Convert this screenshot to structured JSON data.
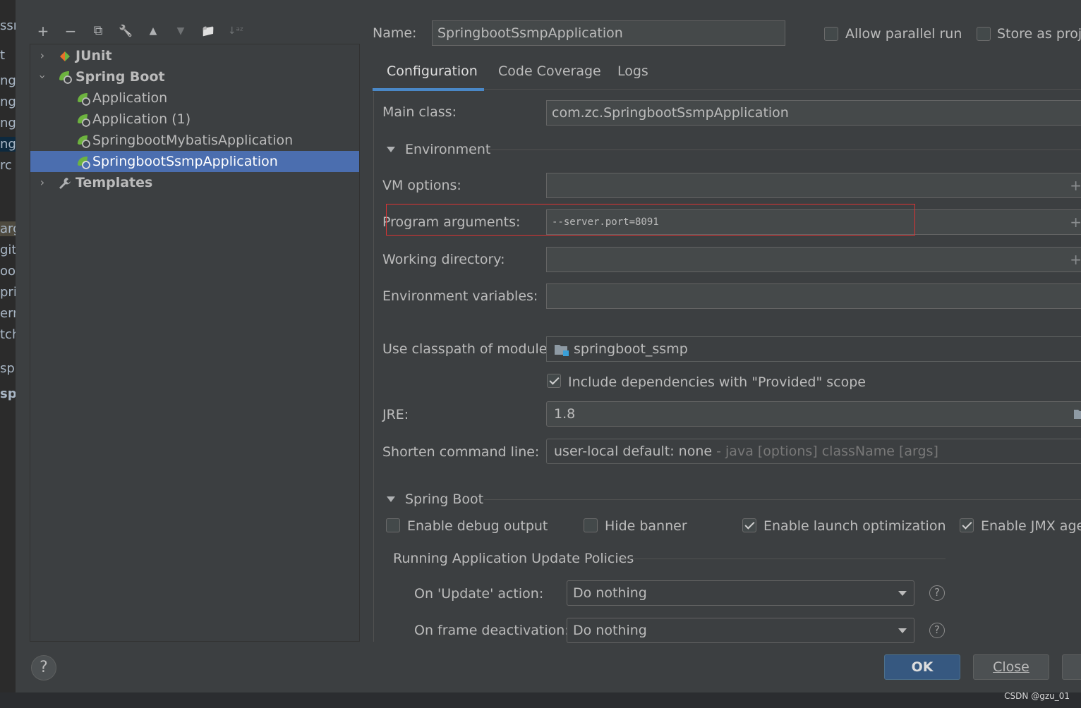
{
  "left_strip": {
    "lines": [
      "ssn",
      "t",
      "ng",
      "ng",
      "ng",
      "ng",
      "rc",
      "",
      "",
      "arg",
      "git",
      "oor",
      "pri",
      "ern",
      "tch",
      "sp",
      "sp"
    ]
  },
  "toolbar": {
    "add": "+",
    "remove": "−",
    "copy": "⧉",
    "edit_defaults": "🔧",
    "move_up": "▲",
    "move_down": "▼",
    "folder": "📁",
    "sort": "↓ᵃᶻ"
  },
  "tree": {
    "items": [
      {
        "label": "JUnit",
        "expanded": false
      },
      {
        "label": "Spring Boot",
        "expanded": true
      },
      {
        "label": "Application"
      },
      {
        "label": "Application (1)"
      },
      {
        "label": "SpringbootMybatisApplication"
      },
      {
        "label": "SpringbootSsmpApplication",
        "selected": true
      },
      {
        "label": "Templates",
        "expanded": false
      }
    ]
  },
  "header": {
    "name_label": "Name:",
    "name_value": "SpringbootSsmpApplication",
    "allow_parallel": "Allow parallel run",
    "store_as_project": "Store as proje"
  },
  "tabs": [
    {
      "label": "Configuration",
      "active": true
    },
    {
      "label": "Code Coverage"
    },
    {
      "label": "Logs"
    }
  ],
  "config": {
    "main_class_label": "Main class:",
    "main_class_value": "com.zc.SpringbootSsmpApplication",
    "environment_label": "Environment",
    "vm_options_label": "VM options:",
    "vm_options_value": "",
    "program_args_label": "Program arguments:",
    "program_args_value": "--server.port=8091",
    "working_dir_label": "Working directory:",
    "working_dir_value": "",
    "env_vars_label": "Environment variables:",
    "env_vars_value": "",
    "classpath_label": "Use classpath of module:",
    "classpath_value": "springboot_ssmp",
    "include_provided_label": "Include dependencies with \"Provided\" scope",
    "jre_label": "JRE:",
    "jre_value": "1.8",
    "shorten_label": "Shorten command line:",
    "shorten_value": "user-local default: none",
    "shorten_hint": " - java [options] className [args]"
  },
  "spring_boot": {
    "section_label": "Spring Boot",
    "debug_output": "Enable debug output",
    "hide_banner": "Hide banner",
    "launch_optimization": "Enable launch optimization",
    "jmx_agent": "Enable JMX agen",
    "policies_label": "Running Application Update Policies",
    "on_update_label": "On 'Update' action:",
    "on_update_value": "Do nothing",
    "on_frame_label": "On frame deactivation:",
    "on_frame_value": "Do nothing",
    "help_glyph": "?"
  },
  "footer": {
    "help": "?",
    "ok": "OK",
    "close": "Close"
  },
  "watermark": "CSDN @gzu_01",
  "colors": {
    "accent": "#4a88c7",
    "selection": "#4b6eaf",
    "ok_button": "#365880",
    "highlight_box": "#dd3333",
    "spring_green": "#6db33f"
  }
}
